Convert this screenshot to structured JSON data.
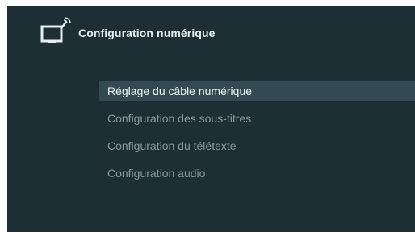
{
  "header": {
    "title": "Configuration numérique",
    "icon": "tv-antenna-icon"
  },
  "menu": {
    "selected_index": 0,
    "items": [
      {
        "label": "Réglage du câble numérique"
      },
      {
        "label": "Configuration des sous-titres"
      },
      {
        "label": "Configuration du télétexte"
      },
      {
        "label": "Configuration audio"
      }
    ]
  },
  "colors": {
    "background": "#1e2e35",
    "selected_background": "#344a52",
    "header_text": "#e8ecee",
    "item_text": "#8b989d"
  }
}
